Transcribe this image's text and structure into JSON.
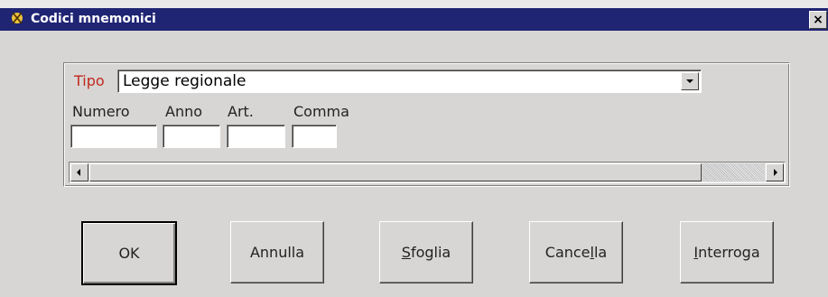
{
  "window": {
    "title": "Codici mnemonici",
    "close_symbol": "×"
  },
  "form": {
    "tipo_label": "Tipo",
    "tipo_value": "Legge regionale",
    "labels": {
      "numero": "Numero",
      "anno": "Anno",
      "art": "Art.",
      "comma": "Comma"
    },
    "values": {
      "numero": "",
      "anno": "",
      "art": "",
      "comma": ""
    }
  },
  "buttons": {
    "ok": "OK",
    "annulla": "Annulla",
    "sfoglia_prefix": "S",
    "sfoglia_rest": "foglia",
    "cancella_prefix": "Cance",
    "cancella_u": "l",
    "cancella_rest": "la",
    "interroga_prefix": "I",
    "interroga_rest": "nterroga"
  },
  "icons": {
    "app": "app-icon",
    "close": "close-icon",
    "dropdown": "chevron-down-icon",
    "scroll_left": "arrow-left-icon",
    "scroll_right": "arrow-right-icon"
  },
  "colors": {
    "titlebar": "#1f2473",
    "window": "#d8d6d4",
    "tipo_label": "#c0281d"
  }
}
